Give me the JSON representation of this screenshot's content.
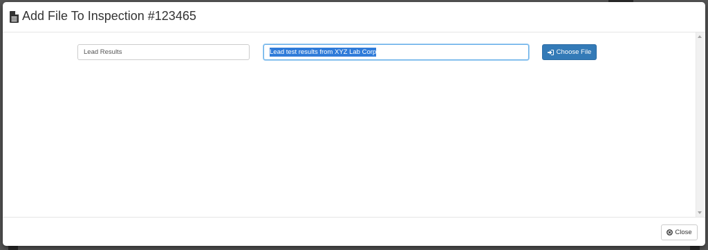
{
  "modal": {
    "title": "Add File To Inspection #123465",
    "title_icon": "file-text-icon"
  },
  "form": {
    "file_name_value": "Lead Results",
    "description_value": "Lead test results from XYZ Lab Corp",
    "description_selected": true,
    "choose_file_label": "Choose File",
    "choose_file_icon": "sign-in-icon"
  },
  "footer": {
    "close_label": "Close",
    "close_icon": "times-circle-icon"
  },
  "colors": {
    "primary": "#337ab7",
    "focus_border": "#66afe9",
    "selection": "#2f7bd9"
  }
}
